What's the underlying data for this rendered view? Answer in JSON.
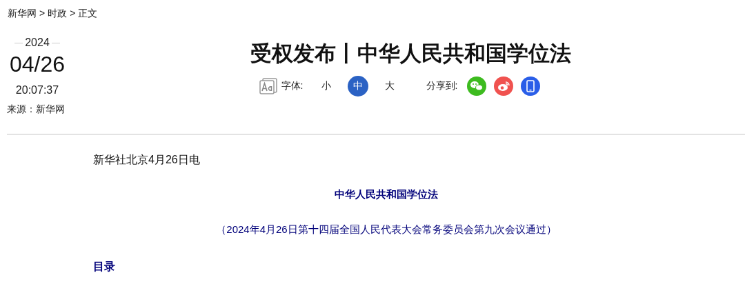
{
  "breadcrumb": [
    "新华网",
    ">",
    "时政",
    ">",
    "正文"
  ],
  "dateline": {
    "year": "2024",
    "date": "04/26",
    "time": "20:07:37",
    "source": "来源：新华网"
  },
  "title": "受权发布丨中华人民共和国学位法",
  "font_size": {
    "label": "字体:",
    "options": [
      {
        "label": "小",
        "selected": false
      },
      {
        "label": "中",
        "selected": true
      },
      {
        "label": "大",
        "selected": false
      }
    ]
  },
  "share": {
    "label": "分享到:",
    "targets": [
      {
        "kind": "wechat"
      },
      {
        "kind": "weibo"
      },
      {
        "kind": "mobile"
      }
    ]
  },
  "body": [
    {
      "kind": "lead",
      "text": "新华社北京4月26日电"
    },
    {
      "kind": "heading",
      "text": "中华人民共和国学位法"
    },
    {
      "kind": "note",
      "text": "（2024年4月26日第十四届全国人民代表大会常务委员会第九次会议通过）"
    },
    {
      "kind": "section",
      "text": "目录"
    }
  ]
}
